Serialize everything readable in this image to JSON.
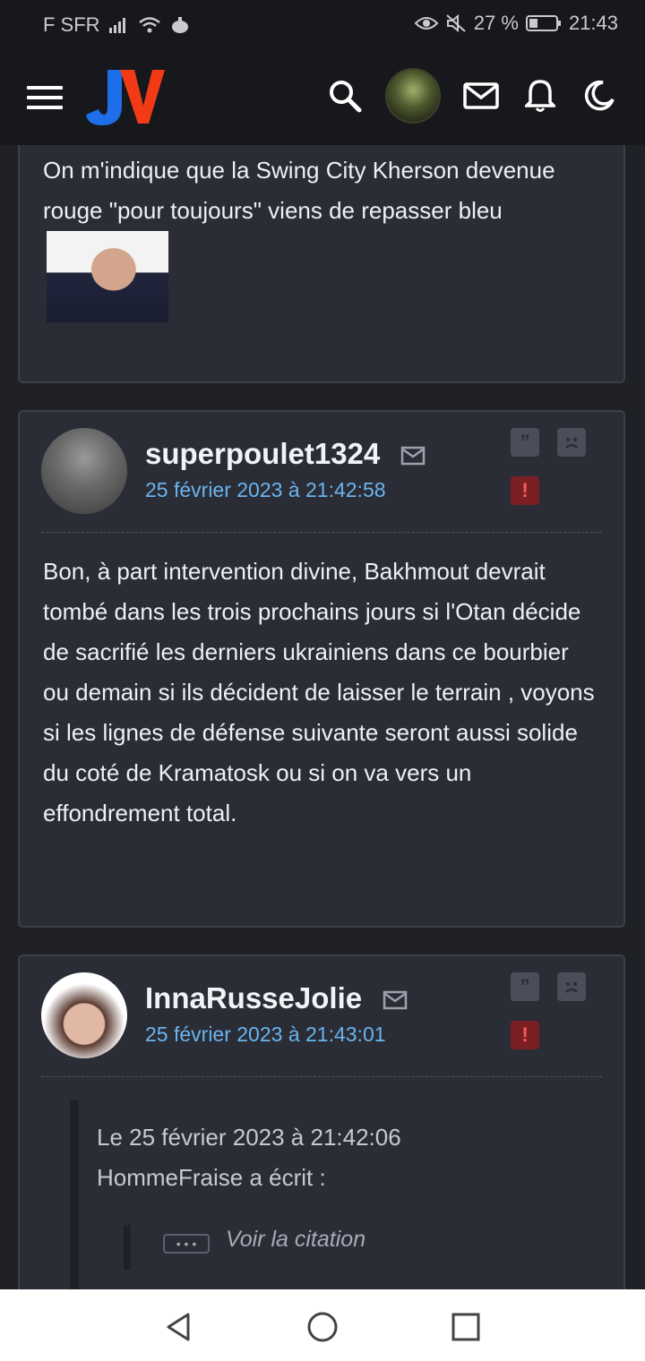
{
  "status": {
    "carrier": "F SFR",
    "battery": "27 %",
    "time": "21:43"
  },
  "topbar": {
    "logo": "JV"
  },
  "posts": [
    {
      "text_before_image": "On m'indique que la Swing City Kherson devenue rouge \"pour toujours\" viens de repasser bleu"
    },
    {
      "username": "superpoulet1324",
      "date": "25 février 2023 à 21:42:58",
      "body": "Bon, à part intervention divine, Bakhmout devrait tombé dans les trois prochains jours si l'Otan décide de sacrifié les derniers ukrainiens dans ce bourbier ou demain si ils décident de laisser le terrain , voyons si les lignes de défense suivante seront aussi solide du coté de Kramatosk ou si on va vers un effondrement total."
    },
    {
      "username": "InnaRusseJolie",
      "date": "25 février 2023 à 21:43:01",
      "quote_line1": "Le 25 février 2023 à 21:42:06",
      "quote_line2": "HommeFraise a écrit :",
      "voir_button": "• • •",
      "voir_label": "Voir la citation"
    }
  ],
  "icons": [
    "signal-icon",
    "wifi-icon",
    "menu-icon",
    "search-icon",
    "mail-icon",
    "bell-icon",
    "moon-icon",
    "quote-icon",
    "sad-icon",
    "alert-icon",
    "back-icon",
    "home-icon",
    "recents-icon"
  ]
}
